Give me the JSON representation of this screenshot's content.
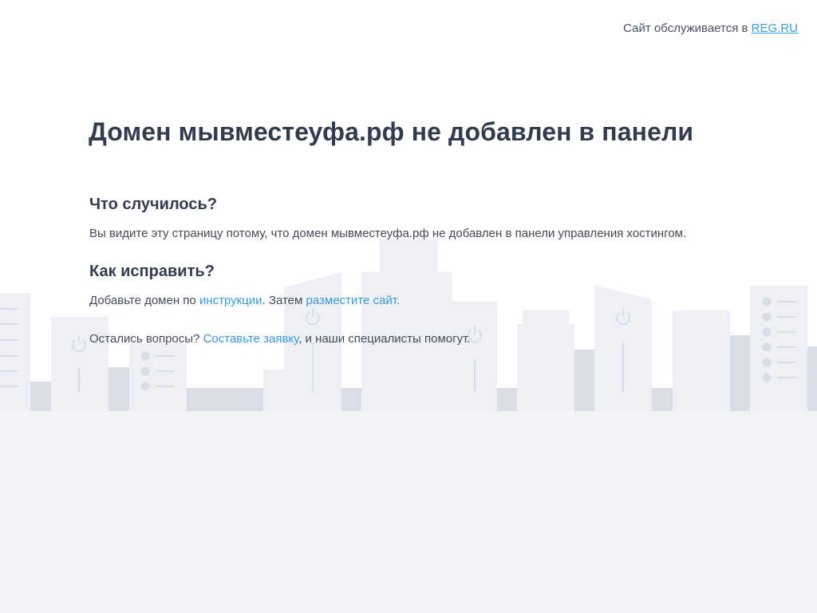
{
  "topbar": {
    "prefix": "Сайт обслуживается в",
    "provider_link": "REG.RU"
  },
  "title": "Домен мывместеуфа.рф не добавлен в панели",
  "what_happened": {
    "heading": "Что случилось?",
    "text": "Вы видите эту страницу потому, что домен мывместеуфа.рф не добавлен в панели управления хостингом."
  },
  "how_to_fix": {
    "heading": "Как исправить?",
    "text_before": "Добавьте домен по",
    "instructions_link": "инструкции",
    "text_middle": ". Затем",
    "place_site_link": "разместите сайт."
  },
  "questions": {
    "text_before": "Остались вопросы?",
    "request_link": "Составьте заявку",
    "text_after": ", и наши специалисты помогут."
  },
  "colors": {
    "background": "#ffffff",
    "ground": "#f2f3f7",
    "building_light": "#eef0f5",
    "building_dark": "#d9dde6",
    "text": "#333b4e",
    "link": "#3a9ad9"
  }
}
